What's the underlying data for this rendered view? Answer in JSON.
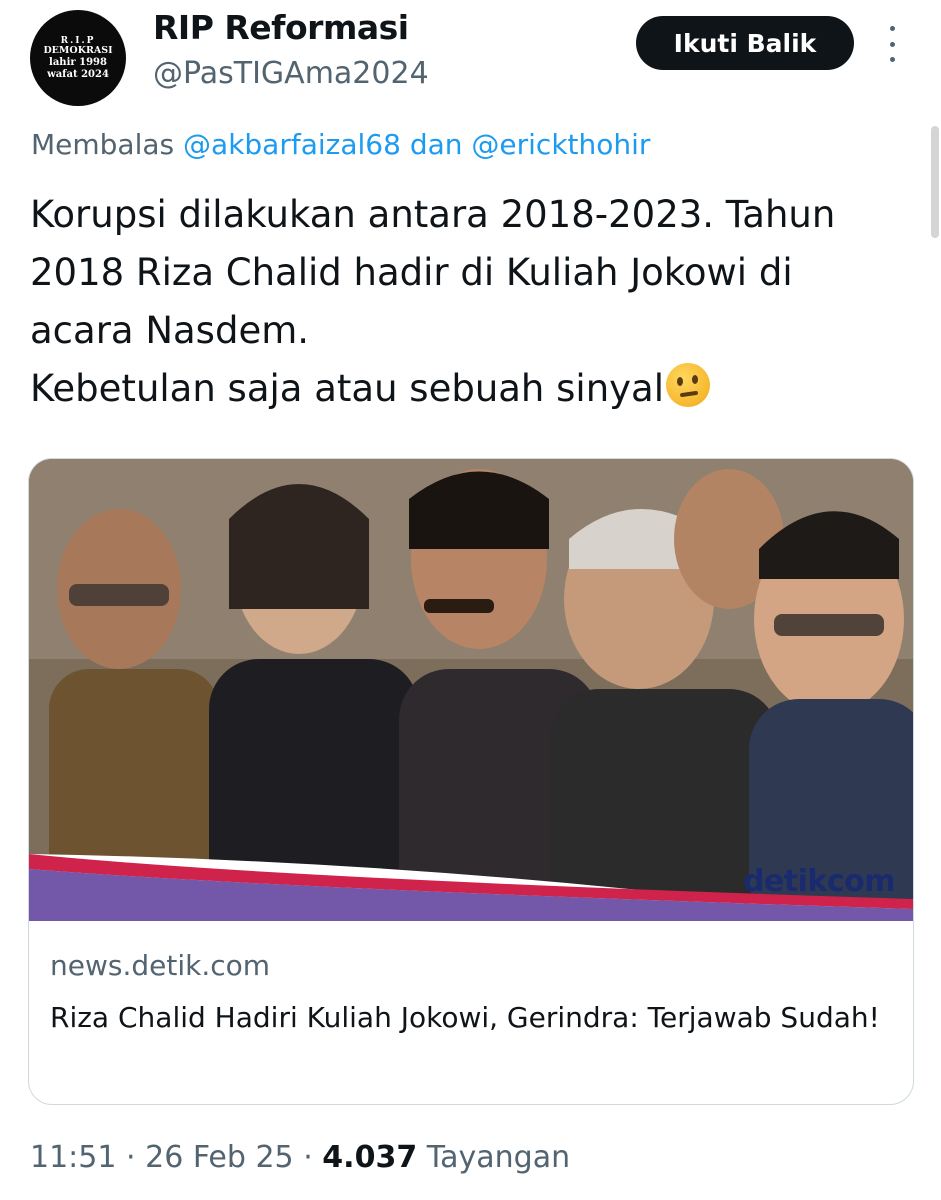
{
  "profile": {
    "avatar_lines": [
      "R.I.P",
      "DEMOKRASI",
      "lahir 1998",
      "wafat 2024"
    ],
    "display_name": "RIP Reformasi",
    "handle": "@PasTIGAma2024"
  },
  "actions": {
    "follow_label": "Ikuti Balik",
    "more_icon": "more-vertical-icon"
  },
  "reply": {
    "prefix": "Membalas",
    "mention1": "@akbarfaizal68",
    "joiner": "dan",
    "mention2": "@erickthohir"
  },
  "tweet": {
    "lines": [
      "Korupsi dilakukan antara 2018-2023. Tahun",
      "2018 Riza Chalid hadir di Kuliah Jokowi di",
      "acara Nasdem.",
      "Kebetulan saja atau sebuah sinyal"
    ],
    "emoji": "thinking-face-icon"
  },
  "card": {
    "watermark": "detikcom",
    "domain": "news.detik.com",
    "title": "Riza Chalid Hadiri Kuliah Jokowi, Gerindra: Terjawab Sudah!"
  },
  "meta": {
    "time": "11:51",
    "sep1": "·",
    "date": "26 Feb 25",
    "sep2": "·",
    "views_count": "4.037",
    "views_label": "Tayangan"
  },
  "colors": {
    "link": "#1d9bf0",
    "secondary": "#536471",
    "primary": "#0f1419"
  }
}
